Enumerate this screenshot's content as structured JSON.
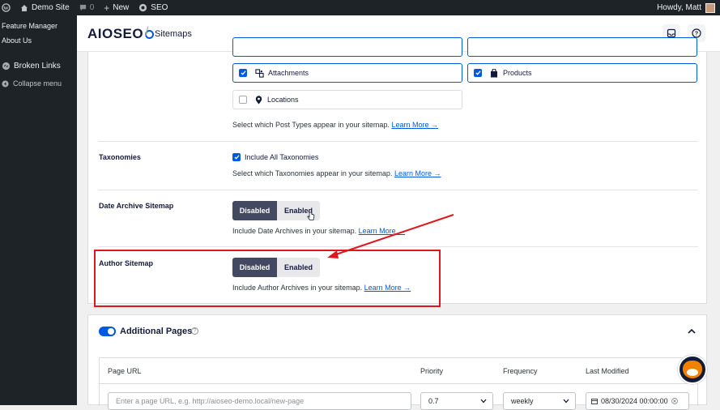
{
  "admin_bar": {
    "site_name": "Demo Site",
    "comments_count": "0",
    "new_label": "New",
    "seo_label": "SEO",
    "greeting": "Howdy, Matt"
  },
  "sidebar": {
    "links": [
      "Feature Manager",
      "About Us"
    ],
    "broken_links_label": "Broken Links",
    "collapse_label": "Collapse menu"
  },
  "header": {
    "logo_text": "AIOSEO",
    "separator": "/",
    "page_title": "Sitemaps"
  },
  "post_types": [
    {
      "label": "Attachments",
      "checked": true,
      "icon": "attachments-icon"
    },
    {
      "label": "Products",
      "checked": true,
      "icon": "products-icon"
    },
    {
      "label": "Locations",
      "checked": false,
      "icon": "location-pin-icon"
    }
  ],
  "post_types_desc": "Select which Post Types appear in your sitemap.",
  "learn_more": "Learn More →",
  "taxonomies": {
    "label": "Taxonomies",
    "checkbox_label": "Include All Taxonomies",
    "checked": true,
    "desc": "Select which Taxonomies appear in your sitemap."
  },
  "date_archive": {
    "label": "Date Archive Sitemap",
    "disabled_label": "Disabled",
    "enabled_label": "Enabled",
    "selected": "Disabled",
    "desc": "Include Date Archives in your sitemap."
  },
  "author_sitemap": {
    "label": "Author Sitemap",
    "disabled_label": "Disabled",
    "enabled_label": "Enabled",
    "selected": "Disabled",
    "desc": "Include Author Archives in your sitemap."
  },
  "additional_pages": {
    "title": "Additional Pages",
    "enabled": true,
    "columns": [
      "Page URL",
      "Priority",
      "Frequency",
      "Last Modified"
    ],
    "url_placeholder": "Enter a page URL, e.g. http://aioseo-demo.local/new-page",
    "priority": "0.7",
    "frequency": "weekly",
    "last_modified": "08/30/2024 00:00:00"
  },
  "colors": {
    "accent": "#005ae0",
    "toggle_active": "#434960",
    "annotation": "#e0161f",
    "admin_bar": "#1d2327"
  }
}
